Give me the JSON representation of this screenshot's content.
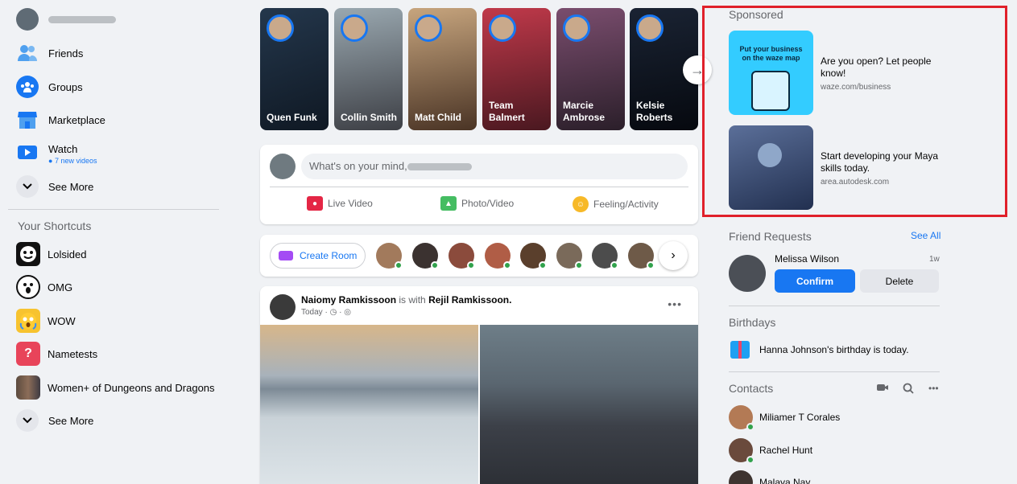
{
  "left_nav": {
    "profile_name": "",
    "items": [
      {
        "label": "Friends",
        "icon": "friends-icon"
      },
      {
        "label": "Groups",
        "icon": "groups-icon"
      },
      {
        "label": "Marketplace",
        "icon": "marketplace-icon"
      },
      {
        "label": "Watch",
        "sub": "7 new videos",
        "icon": "watch-icon"
      },
      {
        "label": "See More",
        "icon": "chevron-down-icon"
      }
    ],
    "shortcuts_title": "Your Shortcuts",
    "shortcuts": [
      {
        "label": "Lolsided"
      },
      {
        "label": "OMG"
      },
      {
        "label": "WOW"
      },
      {
        "label": "Nametests"
      },
      {
        "label": "Women+ of Dungeons and Dragons"
      },
      {
        "label": "See More"
      }
    ]
  },
  "stories": [
    {
      "name": "Quen Funk",
      "color": "#1c2a3a"
    },
    {
      "name": "Collin Smith",
      "color": "#6b7f89"
    },
    {
      "name": "Matt Child",
      "color": "#7a5a40"
    },
    {
      "name": "Team Balmert",
      "color": "#a23340"
    },
    {
      "name": "Marcie Ambrose",
      "color": "#5d3b55"
    },
    {
      "name": "Kelsie Roberts",
      "color": "#0e1420"
    }
  ],
  "composer": {
    "placeholder": "What's on your mind,",
    "actions": [
      {
        "label": "Live Video",
        "color": "#e42645"
      },
      {
        "label": "Photo/Video",
        "color": "#45bd62"
      },
      {
        "label": "Feeling/Activity",
        "color": "#f7b928"
      }
    ]
  },
  "room": {
    "create_label": "Create Room"
  },
  "post": {
    "author": "Naiomy Ramkissoon",
    "with_text": "is with",
    "tagged": "Rejil Ramkissoon.",
    "time": "Today ·"
  },
  "sponsored": {
    "title": "Sponsored",
    "ads": [
      {
        "text": "Are you open? Let people know!",
        "url": "waze.com/business",
        "image_caption": "Put your business on the waze map",
        "color": "#33ccff"
      },
      {
        "text": "Start developing your Maya skills today.",
        "url": "area.autodesk.com",
        "color": "#3a4a6b"
      }
    ]
  },
  "friend_requests": {
    "title": "Friend Requests",
    "see_all": "See All",
    "name": "Melissa Wilson",
    "time": "1w",
    "confirm": "Confirm",
    "delete": "Delete"
  },
  "birthdays": {
    "title": "Birthdays",
    "name": "Hanna Johnson",
    "text": "'s birthday is today."
  },
  "contacts": {
    "title": "Contacts",
    "list": [
      {
        "name": "Miliamer T Corales"
      },
      {
        "name": "Rachel Hunt"
      },
      {
        "name": "Malaya Nay"
      }
    ]
  }
}
